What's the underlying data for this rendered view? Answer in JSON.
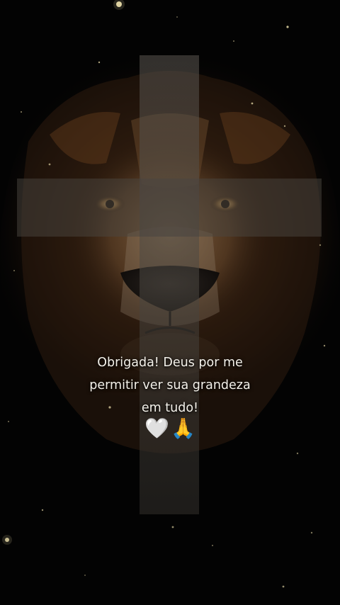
{
  "caption": {
    "line1": "Obrigada! Deus por me",
    "line2": "permitir ver sua grandeza",
    "line3": "em tudo!"
  },
  "emojis": [
    {
      "icon": "white-heart-icon",
      "char": "🤍"
    },
    {
      "icon": "praying-hands-icon",
      "char": "🙏"
    }
  ],
  "colors": {
    "background": "#030303",
    "cross": "#4a4640",
    "caption_text": "#f4f1ea",
    "lion_mane": "#5a3a1e"
  }
}
